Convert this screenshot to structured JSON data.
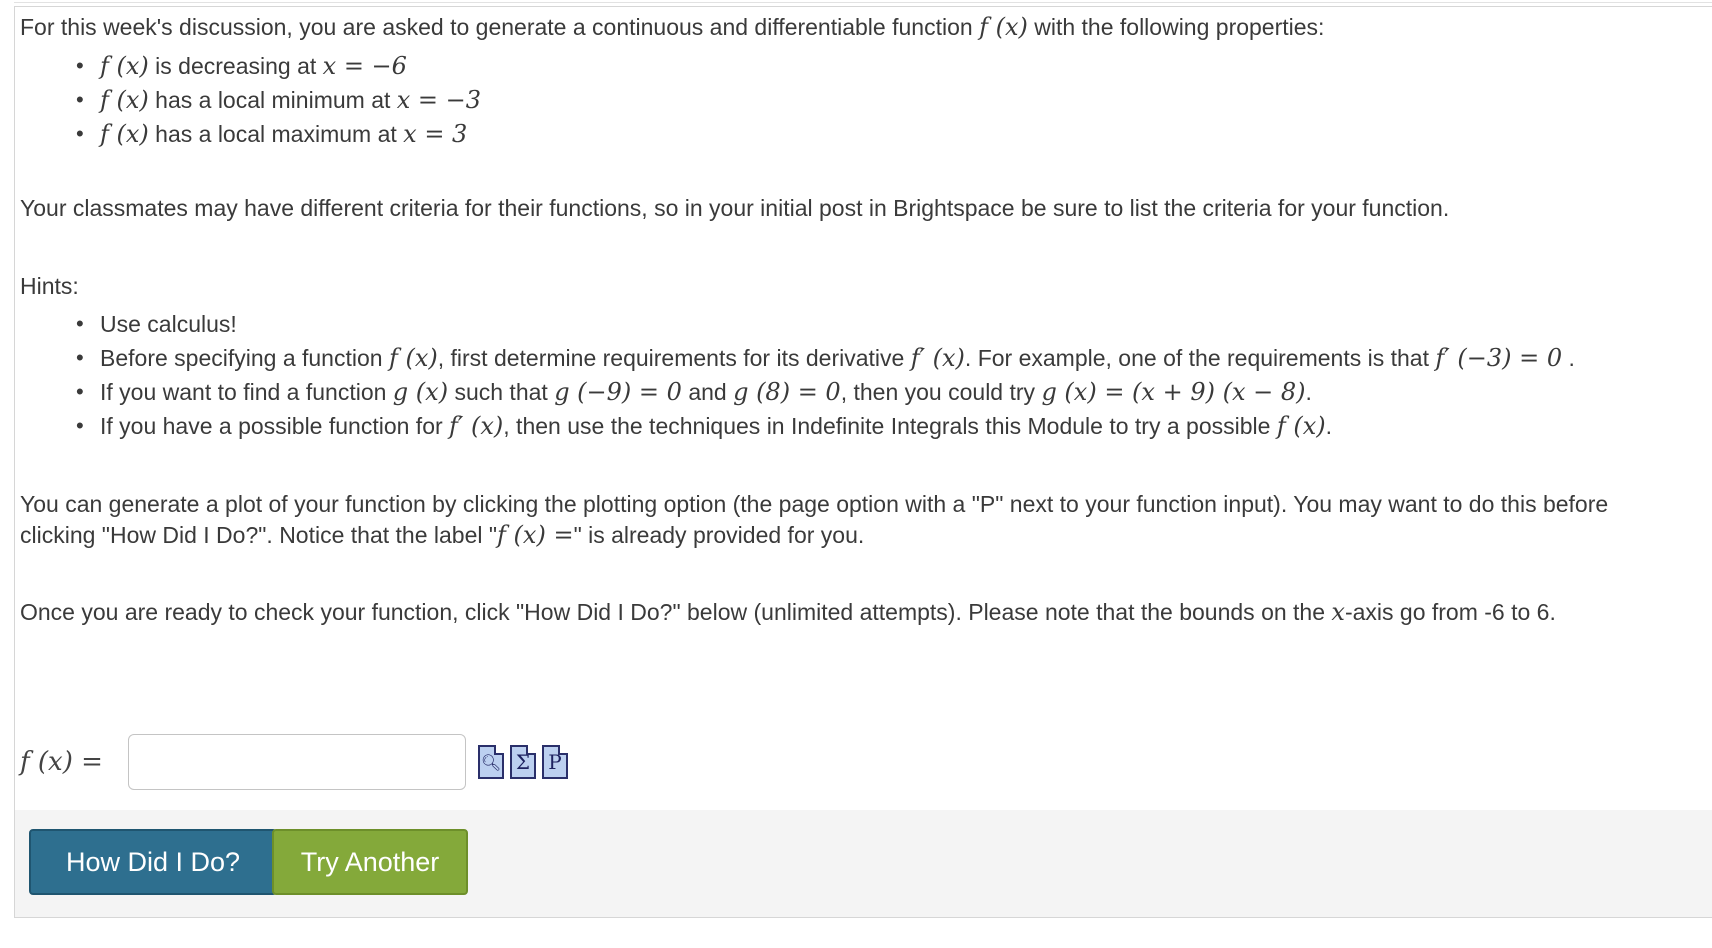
{
  "intro": {
    "lead": "For this week's discussion, you are asked to generate a continuous and differentiable function",
    "fx": "f (x)",
    "tail": "with the following properties:"
  },
  "properties": [
    {
      "fx": "f (x)",
      "text": "is decreasing at",
      "math": "x = −6"
    },
    {
      "fx": "f (x)",
      "text": "has a local minimum at",
      "math": "x = −3"
    },
    {
      "fx": "f (x)",
      "text": "has a local maximum at",
      "math": "x = 3"
    }
  ],
  "classmates_note": "Your classmates may have different criteria for their functions, so in your initial post in Brightspace be sure to list the criteria for your function.",
  "hints_title": "Hints:",
  "hints": {
    "h1": "Use calculus!",
    "h2": {
      "a": "Before specifying a function",
      "m1": "f (x)",
      "b": ", first determine requirements for its derivative",
      "m2": "f′ (x)",
      "c": ". For example, one of the requirements is that",
      "m3": "f′ (−3) = 0",
      "d": "."
    },
    "h3": {
      "a": "If you want to find a function",
      "m1": "g (x)",
      "b": "such that",
      "m2": "g (−9) = 0",
      "c": "and",
      "m3": "g (8) = 0",
      "d": ", then you could try",
      "m4": "g (x) = (x + 9) (x − 8)",
      "e": "."
    },
    "h4": {
      "a": "If you have a possible function for",
      "m1": "f′ (x)",
      "b": ", then use the techniques in Indefinite Integrals this Module to try a possible",
      "m2": "f (x)",
      "c": "."
    }
  },
  "plot_note": {
    "line1": "You can generate a plot of your function by clicking the plotting option (the page option with a \"P\" next to your function input). You may want to do this before",
    "line2a": "clicking \"How Did I Do?\". Notice that the label \"",
    "line2m": "f (x) =",
    "line2b": "\" is already provided for you."
  },
  "check_note": {
    "a": "Once you are ready to check your function, click \"How Did I Do?\" below (unlimited attempts). Please note that the bounds on the",
    "m": "x",
    "b": "-axis go from -6 to 6."
  },
  "answer": {
    "label": "f (x) =",
    "value": "",
    "tools": [
      "preview-icon",
      "sigma-icon",
      "plot-p-icon"
    ]
  },
  "buttons": {
    "check": "How Did I Do?",
    "try": "Try Another"
  },
  "colors": {
    "check_button": "#2e6f8f",
    "try_button": "#84a93a",
    "footer_bg": "#f4f4f4"
  }
}
